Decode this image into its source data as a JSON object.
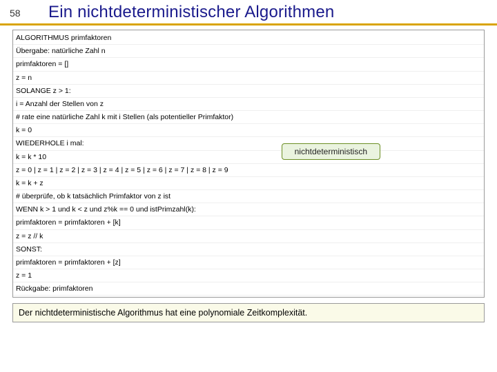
{
  "header": {
    "pagenum": "58",
    "title": "Ein nichtdeterministischer Algorithmen"
  },
  "algo": {
    "l0": "ALGORITHMUS primfaktoren",
    "l1": "Übergabe: natürliche Zahl n",
    "l2": "primfaktoren = []",
    "l3": "z = n",
    "l4": "SOLANGE z > 1:",
    "l5": "i = Anzahl der Stellen von z",
    "l6": "# rate eine natürliche Zahl k mit i Stellen (als potentieller Primfaktor)",
    "l7": "k = 0",
    "l8": "WIEDERHOLE i mal:",
    "l9": "k = k * 10",
    "l10": "z = 0 | z = 1 | z = 2 | z = 3 | z = 4 | z = 5 | z = 6 | z = 7 | z = 8 | z = 9",
    "l11": "k = k + z",
    "l12": "# überprüfe, ob k tatsächlich Primfaktor von z ist",
    "l13": "WENN k > 1 und k < z und z%k == 0 und istPrimzahl(k):",
    "l14": "primfaktoren = primfaktoren + [k]",
    "l15": "z = z // k",
    "l16": "SONST:",
    "l17": "primfaktoren = primfaktoren + [z]",
    "l18": "z = 1",
    "l19": "Rückgabe: primfaktoren"
  },
  "callout": {
    "label": "nichtdeterministisch"
  },
  "footer": {
    "text": "Der nichtdeterministische Algorithmus hat eine polynomiale Zeitkomplexität."
  }
}
